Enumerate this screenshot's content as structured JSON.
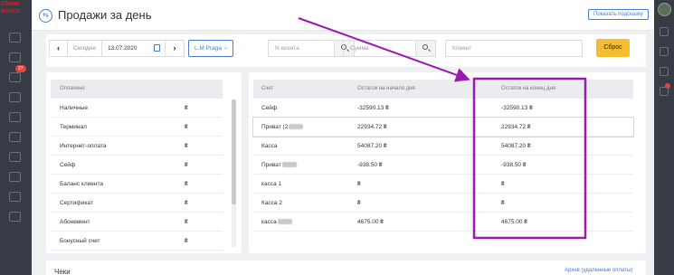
{
  "app": {
    "logo_line1": "Clever",
    "logo_line2": "BOXES",
    "sidebar_badge": "27"
  },
  "header": {
    "title": "Продажи за день",
    "hint_button": "Показать подсказку"
  },
  "filters": {
    "prev": "‹",
    "today": "Сегодня",
    "date": "13.07.2020",
    "next": "›",
    "location": "L.M Praga",
    "visit_placeholder": "N визита",
    "amount_placeholder": "Сумма",
    "client_placeholder": "Клиент",
    "reset_button": "Сброс"
  },
  "paid_table": {
    "header": "Оплачено",
    "rows": [
      {
        "label": "Наличные",
        "value": "₴"
      },
      {
        "label": "Терминал",
        "value": "₴"
      },
      {
        "label": "Интернет-оплата",
        "value": "₴"
      },
      {
        "label": "Сейф",
        "value": "₴"
      },
      {
        "label": "Баланс клиента",
        "value": "₴"
      },
      {
        "label": "Сертификат",
        "value": "₴"
      },
      {
        "label": "Абонемент",
        "value": "₴"
      },
      {
        "label": "Бонусный счет",
        "value": "₴"
      }
    ]
  },
  "accounts_table": {
    "columns": [
      "Счет",
      "Остаток на начало дня",
      "Остаток на конец дня"
    ],
    "rows": [
      {
        "account": "Сейф",
        "start": "-32590.13 ₴",
        "end": "-32590.13 ₴"
      },
      {
        "account": "Приват (2",
        "start": "22934.72 ₴",
        "end": "22934.72 ₴"
      },
      {
        "account": "Касса",
        "start": "54087.20 ₴",
        "end": "54087.20 ₴"
      },
      {
        "account": "Приват",
        "start": "-938.50 ₴",
        "end": "-938.50 ₴"
      },
      {
        "account": "касса 1",
        "start": "₴",
        "end": "₴"
      },
      {
        "account": "Касса 2",
        "start": "₴",
        "end": "₴"
      },
      {
        "account": "касса",
        "start": "4675.00 ₴",
        "end": "4675.00 ₴"
      }
    ]
  },
  "receipts": {
    "title": "Чеки",
    "archive_link": "Архив (удаленные оплаты)"
  },
  "colors": {
    "accent": "#4a7bd0",
    "reset": "#f5bd31",
    "annotation": "#9b19b3",
    "sidebar": "#373b45"
  }
}
